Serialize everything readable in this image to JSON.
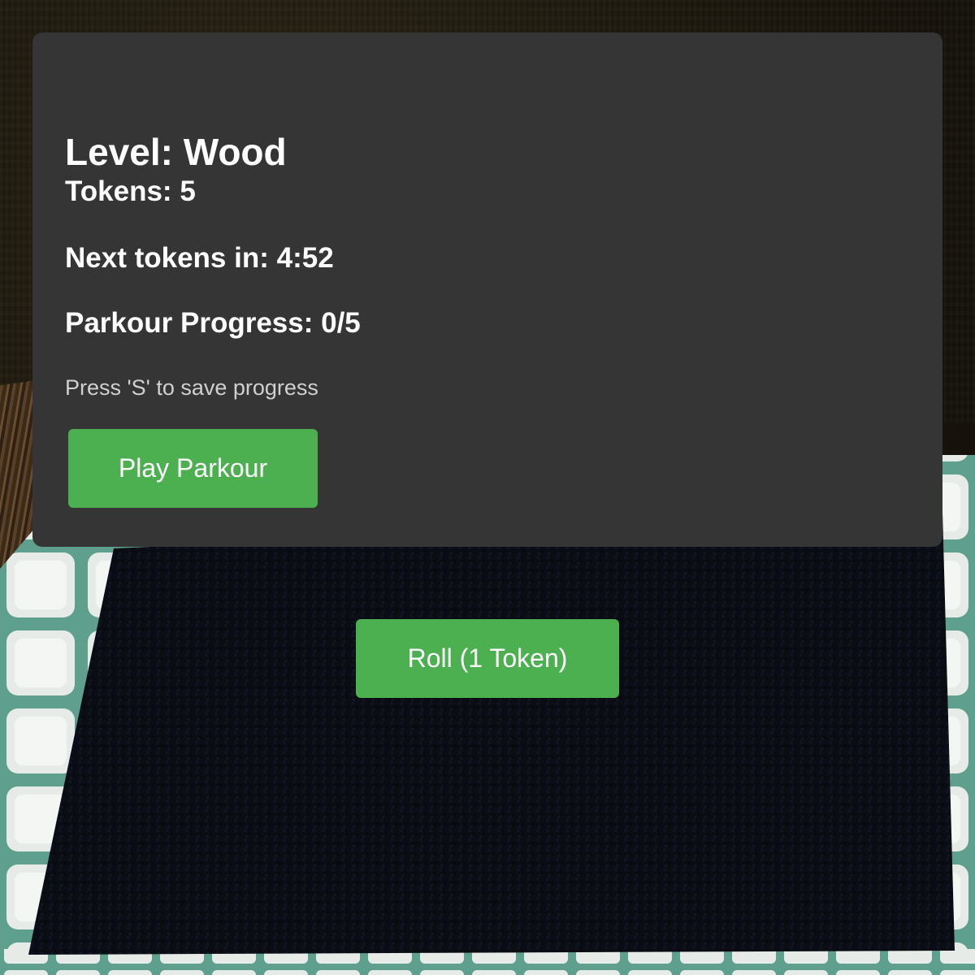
{
  "hud": {
    "level_text": "Level: Wood",
    "tokens_text": "Tokens: 5",
    "next_tokens_text": "Next tokens in: 4:52",
    "parkour_progress_text": "Parkour Progress: 0/5",
    "save_hint": "Press 'S' to save progress",
    "play_parkour_label": "Play Parkour"
  },
  "roll_button_label": "Roll (1 Token)",
  "colors": {
    "panel_bg": "#353535",
    "button_green": "#4caf50",
    "text_white": "#ffffff",
    "hint_gray": "#d0d0d0",
    "floor_dark": "#0b0d14",
    "floor_border_tile": "#e8ece8",
    "floor_border_grout": "#5f9f8e"
  }
}
